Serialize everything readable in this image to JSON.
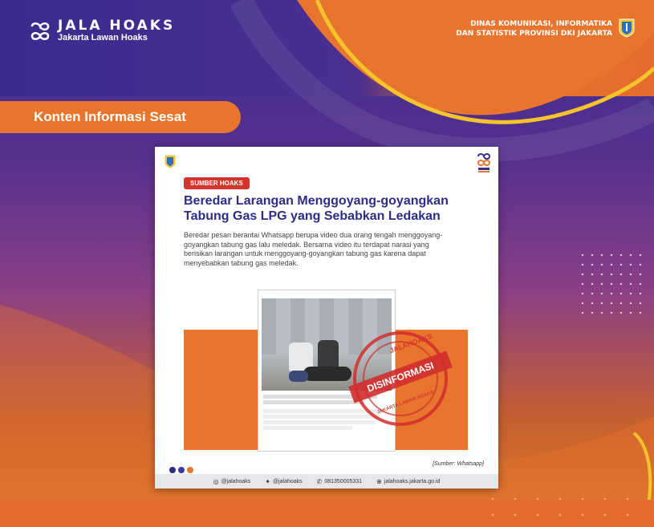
{
  "header": {
    "logo_title": "JALA HOAKS",
    "logo_subtitle": "Jakarta Lawan Hoaks",
    "agency_line1": "DINAS KOMUNIKASI, INFORMATIKA",
    "agency_line2": "DAN STATISTIK PROVINSI DKI JAKARTA"
  },
  "section_title": "Konten Informasi Sesat",
  "card": {
    "badge": "SUMBER HOAKS",
    "headline_line1": "Beredar Larangan Menggoyang-goyangkan",
    "headline_line2": "Tabung Gas LPG yang Sebabkan Ledakan",
    "description": "Beredar pesan berantai Whatsapp berupa video dua orang tengah menggoyang-goyangkan tabung gas lalu meledak. Bersama video itu terdapat narasi yang berisikan larangan untuk menggoyang-goyangkan tabung gas karena dapat menyebabkan tabung gas meledak.",
    "stamp_label": "DISINFORMASI",
    "stamp_arc_top": "JALAHOAKS",
    "stamp_arc_bottom": "JAKARTA LAWAN HOAKS",
    "source": "[Sumber: Whatsapp]",
    "footer": {
      "instagram": "@jalahoaks",
      "twitter": "@jalahoaks",
      "whatsapp": "081350005331",
      "website": "jalahoaks.jakarta.go.id"
    }
  },
  "colors": {
    "orange": "#e8752d",
    "purple": "#3b2a8c",
    "navy": "#2c2d86",
    "red": "#d3352d"
  }
}
